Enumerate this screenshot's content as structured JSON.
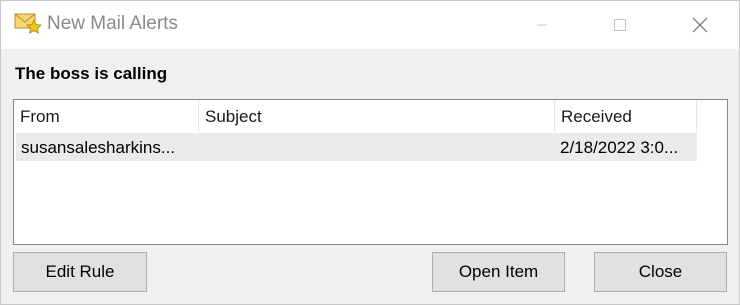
{
  "window": {
    "title": "New Mail Alerts",
    "icon": "mail-star-icon",
    "controls": [
      "minimize-icon",
      "maximize-icon",
      "close-icon"
    ]
  },
  "heading": "The boss is calling",
  "list": {
    "columns": {
      "from": "From",
      "subject": "Subject",
      "received": "Received"
    },
    "rows": [
      {
        "from": "susansalesharkins...",
        "subject": "",
        "received": "2/18/2022 3:0..."
      }
    ]
  },
  "buttons": {
    "edit_rule": "Edit Rule",
    "open_item": "Open Item",
    "close": "Close"
  },
  "colors": {
    "title_text": "#8a8a8a",
    "selected_row": "#ebebeb",
    "button_face": "#e1e1e1",
    "envelope_gold": "#e8b830"
  }
}
